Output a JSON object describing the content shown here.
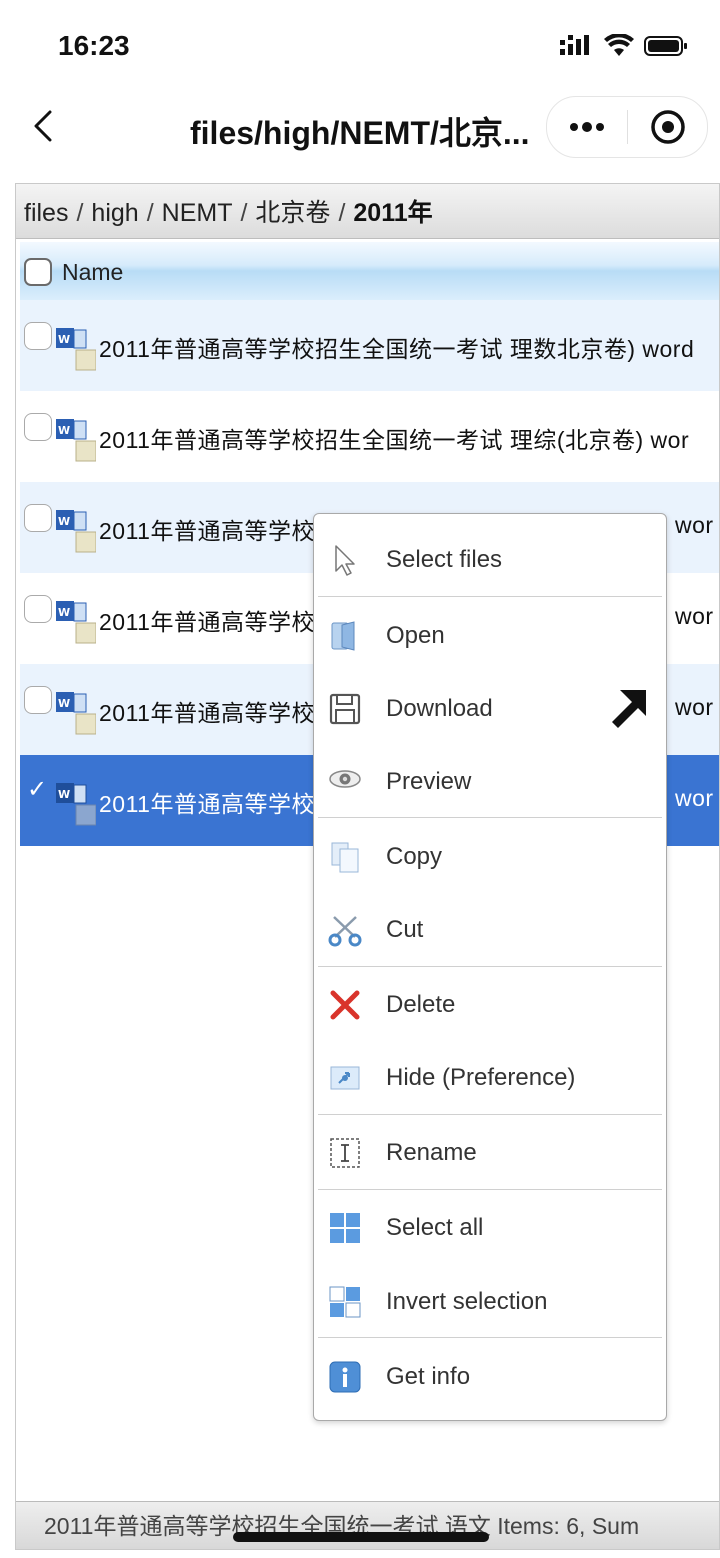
{
  "status_bar": {
    "time": "16:23"
  },
  "nav": {
    "title": "files/high/NEMT/北京..."
  },
  "breadcrumb": {
    "items": [
      "files",
      "high",
      "NEMT",
      "北京卷"
    ],
    "current": "2011年",
    "separator": "/"
  },
  "list_header": {
    "name_label": "Name"
  },
  "files": [
    {
      "name": "2011年普通高等学校招生全国统一考试 理数北京卷) word",
      "selected": false
    },
    {
      "name": "2011年普通高等学校招生全国统一考试 理综(北京卷) wor",
      "selected": false
    },
    {
      "name": "2011年普通高等学校",
      "tail": "wor",
      "selected": false
    },
    {
      "name": "2011年普通高等学校",
      "tail": "wor",
      "selected": false
    },
    {
      "name": "2011年普通高等学校",
      "tail": "wor",
      "selected": false
    },
    {
      "name": "2011年普通高等学校",
      "tail": "wor",
      "selected": true
    }
  ],
  "context_menu": {
    "items": [
      {
        "label": "Select files",
        "icon": "pointer-icon"
      },
      {
        "label": "Open",
        "icon": "open-folder-icon"
      },
      {
        "label": "Download",
        "icon": "floppy-disk-icon"
      },
      {
        "label": "Preview",
        "icon": "eye-icon"
      },
      {
        "label": "Copy",
        "icon": "copy-icon"
      },
      {
        "label": "Cut",
        "icon": "scissors-icon"
      },
      {
        "label": "Delete",
        "icon": "delete-x-icon"
      },
      {
        "label": "Hide (Preference)",
        "icon": "hide-icon"
      },
      {
        "label": "Rename",
        "icon": "rename-icon"
      },
      {
        "label": "Select all",
        "icon": "select-all-icon"
      },
      {
        "label": "Invert selection",
        "icon": "invert-selection-icon"
      },
      {
        "label": "Get info",
        "icon": "info-icon"
      }
    ]
  },
  "footer": {
    "text": "2011年普通高等学校招生全国统一考试 语文  Items: 6, Sum"
  },
  "colors": {
    "selected_row": "#3a74d2",
    "alt_row": "#eaf3fd",
    "delete_icon": "#d9342b"
  }
}
